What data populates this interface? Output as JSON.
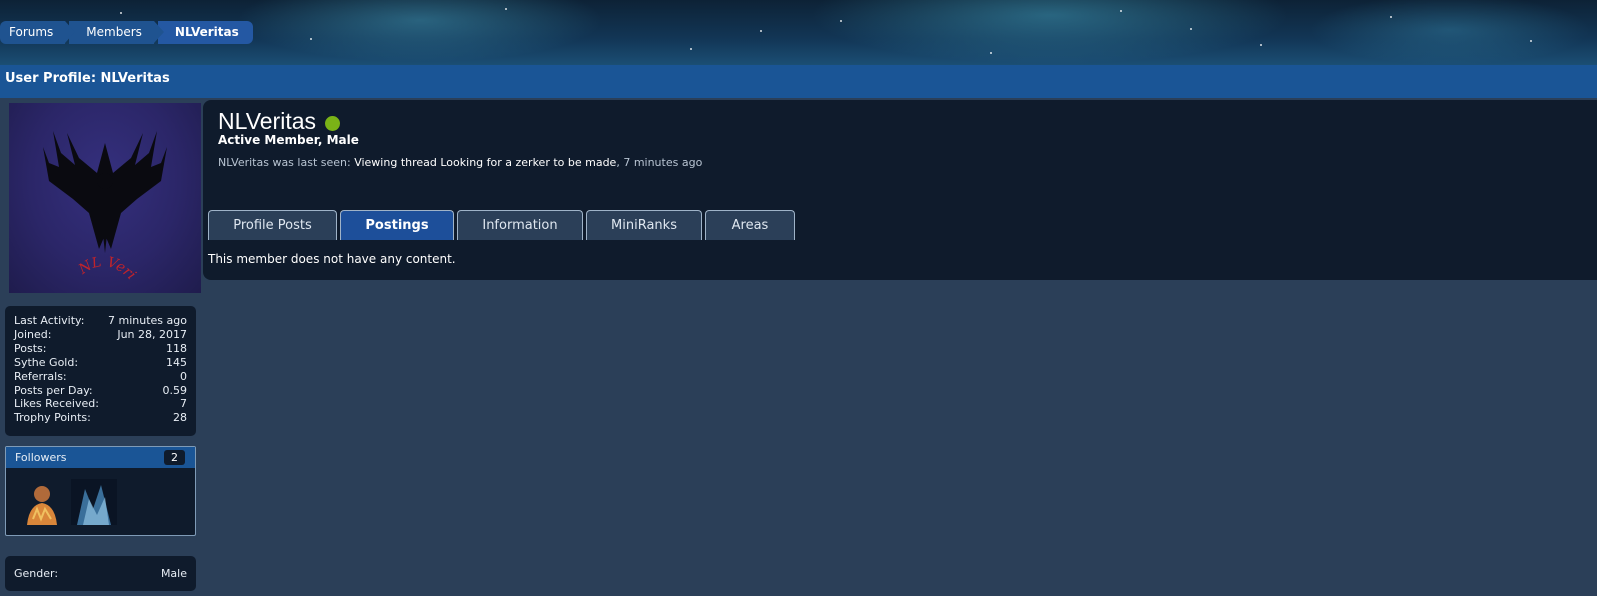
{
  "breadcrumb": {
    "items": [
      "Forums",
      "Members",
      "NLVeritas"
    ]
  },
  "page_title": "User Profile: NLVeritas",
  "avatar": {
    "text": "NL Veritas"
  },
  "stats": [
    {
      "label": "Last Activity:",
      "value": "7 minutes ago"
    },
    {
      "label": "Joined:",
      "value": "Jun 28, 2017"
    },
    {
      "label": "Posts:",
      "value": "118"
    },
    {
      "label": "Sythe Gold:",
      "value": "145"
    },
    {
      "label": "Referrals:",
      "value": "0"
    },
    {
      "label": "Posts per Day:",
      "value": "0.59"
    },
    {
      "label": "Likes Received:",
      "value": "7"
    },
    {
      "label": "Trophy Points:",
      "value": "28"
    }
  ],
  "followers": {
    "title": "Followers",
    "count": "2"
  },
  "gender": {
    "label": "Gender:",
    "value": "Male"
  },
  "profile": {
    "username": "NLVeritas",
    "user_title": "Active Member, Male",
    "last_seen_prefix": "NLVeritas was last seen:",
    "last_seen_action": "Viewing thread",
    "last_seen_thread": "Looking for a zerker to be made",
    "last_seen_time": ", 7 minutes ago"
  },
  "tabs": [
    "Profile Posts",
    "Postings",
    "Information",
    "MiniRanks",
    "Areas"
  ],
  "active_tab": "Postings",
  "content_message": "This member does not have any content.",
  "colors": {
    "online": "#7ab317",
    "accent_blue": "#1a5596",
    "panel_bg": "#0f1b2c",
    "page_bg": "#2b3f58"
  }
}
